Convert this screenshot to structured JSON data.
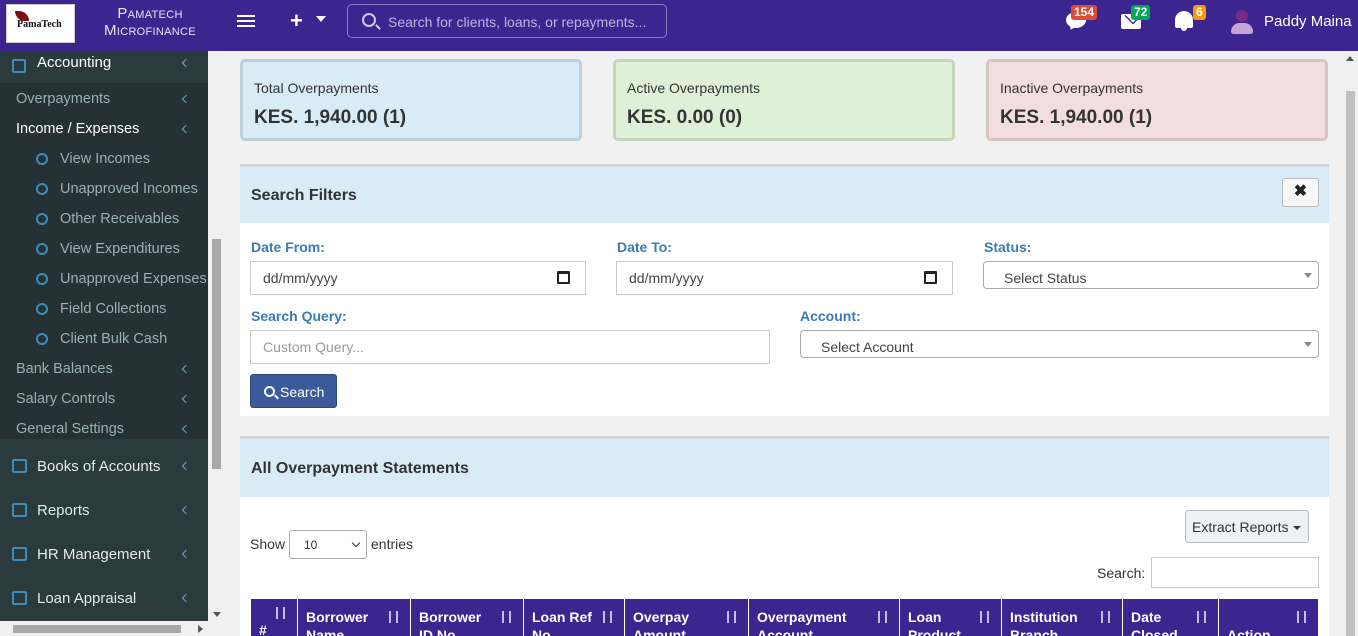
{
  "header": {
    "logo_text": "PamaTech",
    "brand_line1": "Pamatech",
    "brand_line2": "Microfinance",
    "search_placeholder": "Search for clients, loans, or repayments...",
    "badges": {
      "messages": "154",
      "mail": "72",
      "notifications": "6"
    },
    "user_name": "Paddy Maina"
  },
  "sidebar": {
    "section": "Accounting",
    "items": [
      {
        "label": "Overpayments",
        "active": false
      },
      {
        "label": "Income / Expenses",
        "active": true
      }
    ],
    "subitems": [
      "View Incomes",
      "Unapproved Incomes",
      "Other Receivables",
      "View Expenditures",
      "Unapproved Expenses",
      "Field Collections",
      "Client Bulk Cash"
    ],
    "items2": [
      "Bank Balances",
      "Salary Controls",
      "General Settings"
    ],
    "main_items": [
      "Books of Accounts",
      "Reports",
      "HR Management",
      "Loan Appraisal"
    ]
  },
  "stats": [
    {
      "label": "Total Overpayments",
      "value": "KES. 1,940.00 (1)"
    },
    {
      "label": "Active Overpayments",
      "value": "KES. 0.00 (0)"
    },
    {
      "label": "Inactive Overpayments",
      "value": "KES. 1,940.00 (1)"
    }
  ],
  "filters": {
    "title": "Search Filters",
    "close_label": "✖",
    "date_from_label": "Date From:",
    "date_from_value": "dd/mm/yyyy",
    "date_to_label": "Date To:",
    "date_to_value": "dd/mm/yyyy",
    "status_label": "Status:",
    "status_value": "Select Status",
    "query_label": "Search Query:",
    "query_placeholder": "Custom Query...",
    "account_label": "Account:",
    "account_value": "Select Account",
    "search_button": "Search"
  },
  "statements": {
    "title": "All Overpayment Statements",
    "show_label": "Show",
    "entries_value": "10",
    "entries_label": "entries",
    "extract_label": "Extract Reports",
    "search_label": "Search:",
    "columns": [
      "#",
      "Borrower Name",
      "Borrower ID No",
      "Loan Ref No",
      "Overpay Amount",
      "Overpayment Account",
      "Loan Product",
      "Institution Branch",
      "Date Closed",
      "Action"
    ]
  },
  "colors": {
    "topbar": "#3d2590",
    "sidebar": "#2b3a3d",
    "accent_blue": "#3c8dbc",
    "table_header": "#3d2590"
  }
}
